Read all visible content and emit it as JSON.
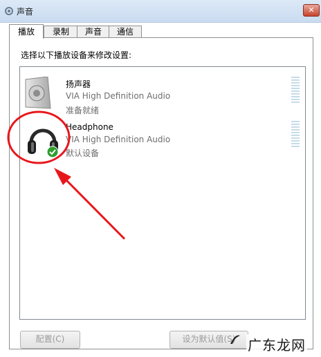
{
  "window": {
    "title": "声音",
    "close_label": "✕"
  },
  "tabs": [
    {
      "label": "播放",
      "active": true
    },
    {
      "label": "录制",
      "active": false
    },
    {
      "label": "声音",
      "active": false
    },
    {
      "label": "通信",
      "active": false
    }
  ],
  "instruction": "选择以下播放设备来修改设置:",
  "devices": [
    {
      "name": "扬声器",
      "description": "VIA High Definition Audio",
      "status": "准备就绪",
      "icon": "speaker-icon"
    },
    {
      "name": "Headphone",
      "description": "VIA High Definition Audio",
      "status": "默认设备",
      "icon": "headphone-icon",
      "default": true
    }
  ],
  "buttons": {
    "configure": "配置(C)",
    "set_default": "设为默认值(S)"
  },
  "watermark": "广东龙网",
  "colors": {
    "annotation_red": "#e8161b",
    "default_check_green": "#2e9e2e"
  }
}
